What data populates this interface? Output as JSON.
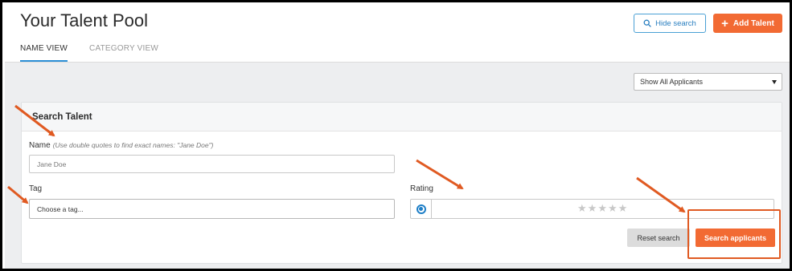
{
  "header": {
    "title": "Your Talent Pool",
    "hide_search_label": "Hide search",
    "add_talent_label": "Add Talent"
  },
  "tabs": [
    {
      "label": "NAME VIEW",
      "active": true
    },
    {
      "label": "CATEGORY VIEW",
      "active": false
    }
  ],
  "filter": {
    "applicants_select": "Show All Applicants"
  },
  "search_card": {
    "title": "Search Talent",
    "name_label": "Name",
    "name_hint": "(Use double quotes to find exact names: \"Jane Doe\")",
    "name_placeholder": "Jane Doe",
    "tag_label": "Tag",
    "tag_value": "Choose a tag...",
    "rating_label": "Rating",
    "rating_stars": 5,
    "rating_value": 0,
    "reset_label": "Reset search",
    "search_label": "Search applicants"
  },
  "colors": {
    "accent_orange": "#f26a33",
    "accent_blue": "#2c8fd6",
    "annotation_arrow": "#e05a22"
  },
  "icons": {
    "hide_search": "search-icon",
    "add_talent": "plus-icon",
    "select": "chevron-down-icon",
    "rating": "star-icon",
    "rating_radio": "radio-selected-icon",
    "annotations": "annotation-arrow-icon"
  }
}
